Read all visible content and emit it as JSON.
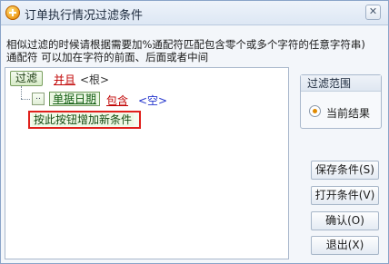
{
  "window": {
    "title": "订单执行情况过滤条件",
    "close_glyph": "✕"
  },
  "hint": "相似过滤的时候请根据需要加%通配符匹配包含零个或多个字符的任意字符串)\n通配符 可以加在字符的前面、后面或者中间",
  "tree": {
    "root_button_label": "过滤",
    "root_operator": "并且",
    "root_label": "<根>",
    "expand_glyph": "..",
    "condition": {
      "field": "单据日期",
      "operator": "包含",
      "value": "<空>"
    },
    "add_condition_label": "按此按钮增加新条件"
  },
  "scope": {
    "title": "过滤范围",
    "option_label": "当前结果",
    "option_selected": true
  },
  "buttons": {
    "save": "保存条件(S)",
    "open": "打开条件(V)",
    "ok": "确认(O)",
    "exit": "退出(X)"
  },
  "colors": {
    "operator_red": "#c00000",
    "value_blue": "#2233cc",
    "highlight_border": "#e0201b",
    "radio_dot": "#e08a00"
  }
}
